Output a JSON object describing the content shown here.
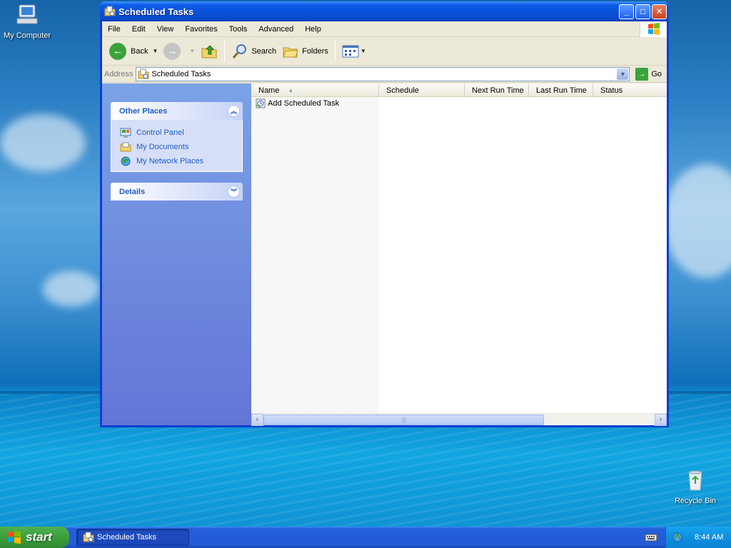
{
  "desktop": {
    "icons": [
      {
        "label": "My Computer",
        "icon": "computer-icon"
      },
      {
        "label": "Recycle Bin",
        "icon": "recycle-bin-icon"
      }
    ]
  },
  "window": {
    "title": "Scheduled Tasks",
    "controls": {
      "minimize": "_",
      "maximize": "□",
      "close": "✕"
    },
    "menu": [
      "File",
      "Edit",
      "View",
      "Favorites",
      "Tools",
      "Advanced",
      "Help"
    ],
    "toolbar": {
      "back": "Back",
      "search": "Search",
      "folders": "Folders"
    },
    "address": {
      "label": "Address",
      "value": "Scheduled Tasks",
      "go": "Go"
    },
    "taskpane": {
      "other_places": {
        "title": "Other Places",
        "links": [
          {
            "label": "Control Panel",
            "icon": "control-panel-icon"
          },
          {
            "label": "My Documents",
            "icon": "my-documents-icon"
          },
          {
            "label": "My Network Places",
            "icon": "network-places-icon"
          }
        ]
      },
      "details": {
        "title": "Details"
      }
    },
    "list": {
      "columns": [
        "Name",
        "Schedule",
        "Next Run Time",
        "Last Run Time",
        "Status"
      ],
      "rows": [
        {
          "name": "Add Scheduled Task",
          "icon": "add-task-icon"
        }
      ]
    }
  },
  "taskbar": {
    "start": "start",
    "tasks": [
      {
        "label": "Scheduled Tasks",
        "icon": "scheduled-tasks-icon"
      }
    ],
    "clock": "8:44 AM"
  },
  "colors": {
    "titlebar": "#0a4fd6",
    "taskpane_link": "#215dc6",
    "start_green": "#3c9d3c",
    "taskbar_blue": "#245edb"
  }
}
